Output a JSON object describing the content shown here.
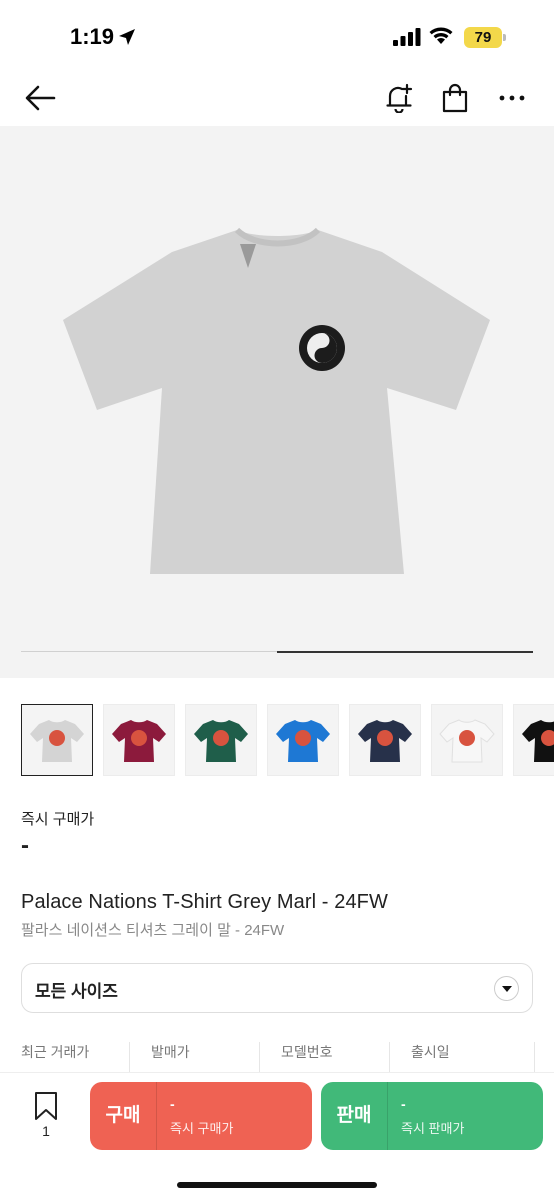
{
  "status_bar": {
    "time": "1:19",
    "battery": "79",
    "colors": {
      "battery": "#f3d84a"
    }
  },
  "nav": {
    "back_icon": "arrow-left-icon",
    "alert_icon": "bell-plus-icon",
    "bag_icon": "shopping-bag-icon",
    "more_icon": "more-horizontal-icon"
  },
  "hero": {
    "image": "grey-tshirt-product-photo",
    "carousel_progress": 0.5
  },
  "thumbnails": [
    {
      "name": "grey",
      "color": "#d4d4d4",
      "selected": true
    },
    {
      "name": "burgundy",
      "color": "#8c1a3c",
      "selected": false
    },
    {
      "name": "green",
      "color": "#1f5e4a",
      "selected": false
    },
    {
      "name": "blue",
      "color": "#1e78d4",
      "selected": false
    },
    {
      "name": "navy",
      "color": "#27314a",
      "selected": false
    },
    {
      "name": "white",
      "color": "#f7f7f7",
      "selected": false
    },
    {
      "name": "black",
      "color": "#111111",
      "selected": false
    }
  ],
  "price": {
    "label": "즉시 구매가",
    "value": "-"
  },
  "product": {
    "title_en": "Palace Nations T-Shirt Grey Marl - 24FW",
    "title_ko": "팔라스 네이션스 티셔츠 그레이 말 - 24FW"
  },
  "size_select": {
    "label": "모든 사이즈",
    "chevron_icon": "chevron-down-icon"
  },
  "info": {
    "recent_trade": "최근 거래가",
    "release_price": "발매가",
    "model_number": "모델번호",
    "release_date": "출시일"
  },
  "bottom_bar": {
    "bookmark_icon": "bookmark-icon",
    "bookmark_count": "1",
    "buy": {
      "label": "구매",
      "value": "-",
      "sub": "즉시 구매가",
      "color": "#ef6253"
    },
    "sell": {
      "label": "판매",
      "value": "-",
      "sub": "즉시 판매가",
      "color": "#41b979"
    }
  }
}
